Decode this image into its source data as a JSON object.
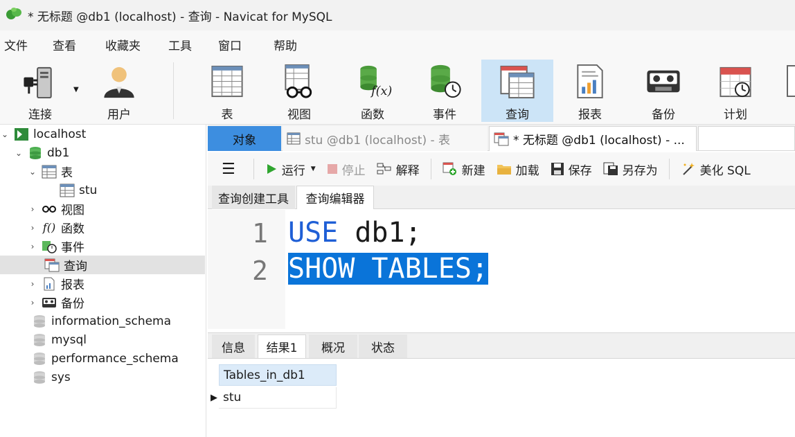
{
  "window": {
    "title": "* 无标题 @db1 (localhost) - 查询 - Navicat for MySQL"
  },
  "menu": [
    "文件",
    "查看",
    "收藏夹",
    "工具",
    "窗口",
    "帮助"
  ],
  "toolbar": {
    "connect": "连接",
    "user": "用户",
    "table": "表",
    "view": "视图",
    "function": "函数",
    "event": "事件",
    "query": "查询",
    "report": "报表",
    "backup": "备份",
    "schedule": "计划"
  },
  "tree": {
    "connection": "localhost",
    "database": "db1",
    "tables_label": "表",
    "table_stu": "stu",
    "views_label": "视图",
    "functions_label": "函数",
    "events_label": "事件",
    "queries_label": "查询",
    "reports_label": "报表",
    "backups_label": "备份",
    "other_dbs": [
      "information_schema",
      "mysql",
      "performance_schema",
      "sys"
    ]
  },
  "tabs": {
    "objects": "对象",
    "stu_tab": "stu @db1 (localhost) - 表",
    "query_tab": "* 无标题 @db1 (localhost) - ..."
  },
  "query_toolbar": {
    "run": "运行",
    "stop": "停止",
    "explain": "解释",
    "new": "新建",
    "load": "加载",
    "save": "保存",
    "save_as": "另存为",
    "beautify": "美化 SQL"
  },
  "subtabs": {
    "builder": "查询创建工具",
    "editor": "查询编辑器"
  },
  "editor": {
    "line1_no": "1",
    "line1_kw": "USE",
    "line1_rest": " db1;",
    "line2_no": "2",
    "line2": "SHOW TABLES;"
  },
  "result_tabs": {
    "info": "信息",
    "result1": "结果1",
    "profile": "概况",
    "status": "状态"
  },
  "result_grid": {
    "column": "Tables_in_db1",
    "rows": [
      "stu"
    ]
  },
  "colors": {
    "active_tab": "#3d8ee0",
    "selection": "#0a74d9",
    "keyword": "#1f5fd6"
  }
}
